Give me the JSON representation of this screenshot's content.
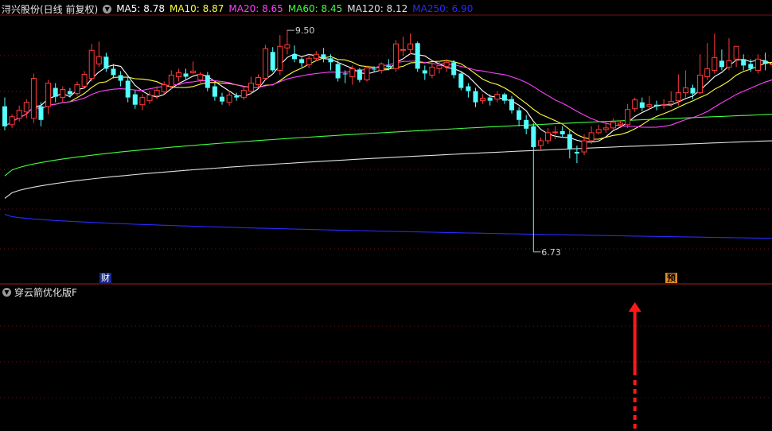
{
  "header": {
    "title": "浔兴股份(日线 前复权)",
    "dropdown_icon": "chevron-down-icon",
    "indicators": [
      {
        "label": "MA5: 8.78",
        "color": "#ffffff"
      },
      {
        "label": "MA10: 8.87",
        "color": "#ffff40"
      },
      {
        "label": "MA20: 8.65",
        "color": "#ff40ff"
      },
      {
        "label": "MA60: 8.45",
        "color": "#40ff40"
      },
      {
        "label": "MA120: 8.12",
        "color": "#e0e0e0"
      },
      {
        "label": "MA250: 6.90",
        "color": "#2a2aff"
      }
    ]
  },
  "sub_panel": {
    "title": "穿云箭优化版F",
    "signal_color": "#ff1a1a"
  },
  "markers": {
    "finance_label": "财",
    "forecast_label": "预"
  },
  "chart_data": {
    "type": "candlestick",
    "up_color": "#ff3a3a",
    "down_color": "#54ffff",
    "grid": true,
    "annotations": [
      {
        "text": "9.50",
        "value": 9.5,
        "candle_index": 39
      },
      {
        "text": "6.73",
        "value": 6.73,
        "candle_index": 73
      }
    ],
    "candles": [
      [
        8.55,
        8.3,
        8.66,
        8.25
      ],
      [
        8.32,
        8.42,
        8.45,
        8.28
      ],
      [
        8.4,
        8.5,
        8.56,
        8.36
      ],
      [
        8.48,
        8.6,
        8.64,
        8.4
      ],
      [
        8.4,
        8.9,
        8.96,
        8.34
      ],
      [
        8.55,
        8.38,
        8.6,
        8.3
      ],
      [
        8.55,
        8.84,
        8.88,
        8.45
      ],
      [
        8.78,
        8.67,
        8.84,
        8.6
      ],
      [
        8.66,
        8.76,
        8.8,
        8.6
      ],
      [
        8.74,
        8.7,
        8.78,
        8.66
      ],
      [
        8.71,
        8.82,
        8.86,
        8.68
      ],
      [
        8.8,
        8.95,
        8.99,
        8.78
      ],
      [
        8.9,
        9.25,
        9.33,
        8.86
      ],
      [
        9.08,
        9.17,
        9.36,
        9.04
      ],
      [
        9.17,
        9.02,
        9.22,
        8.98
      ],
      [
        9.02,
        8.94,
        9.08,
        8.9
      ],
      [
        8.94,
        8.87,
        8.99,
        8.8
      ],
      [
        8.87,
        8.66,
        8.92,
        8.6
      ],
      [
        8.7,
        8.57,
        8.75,
        8.52
      ],
      [
        8.57,
        8.66,
        8.7,
        8.5
      ],
      [
        8.62,
        8.69,
        8.74,
        8.58
      ],
      [
        8.68,
        8.75,
        8.8,
        8.64
      ],
      [
        8.73,
        8.82,
        8.86,
        8.7
      ],
      [
        8.8,
        8.94,
        9.0,
        8.76
      ],
      [
        8.92,
        8.97,
        9.02,
        8.86
      ],
      [
        8.96,
        8.92,
        9.02,
        8.89
      ],
      [
        8.97,
        8.99,
        9.11,
        8.95
      ],
      [
        8.88,
        8.95,
        8.98,
        8.84
      ],
      [
        8.94,
        8.78,
        8.98,
        8.74
      ],
      [
        8.8,
        8.67,
        8.84,
        8.62
      ],
      [
        8.67,
        8.61,
        8.72,
        8.57
      ],
      [
        8.6,
        8.69,
        8.74,
        8.56
      ],
      [
        8.68,
        8.66,
        8.72,
        8.62
      ],
      [
        8.66,
        8.75,
        8.8,
        8.63
      ],
      [
        8.74,
        8.84,
        8.92,
        8.7
      ],
      [
        8.82,
        8.91,
        8.95,
        8.79
      ],
      [
        8.9,
        9.27,
        9.32,
        8.88
      ],
      [
        9.23,
        9.0,
        9.29,
        8.98
      ],
      [
        9.0,
        9.3,
        9.44,
        8.94
      ],
      [
        9.28,
        9.32,
        9.5,
        9.2
      ],
      [
        9.2,
        9.14,
        9.31,
        9.1
      ],
      [
        9.14,
        9.09,
        9.16,
        9.04
      ],
      [
        9.07,
        9.15,
        9.2,
        9.03
      ],
      [
        9.15,
        9.2,
        9.24,
        9.12
      ],
      [
        9.2,
        9.15,
        9.28,
        9.1
      ],
      [
        9.15,
        9.1,
        9.2,
        9.0
      ],
      [
        9.08,
        8.9,
        9.12,
        8.86
      ],
      [
        8.96,
        8.95,
        9.0,
        8.84
      ],
      [
        8.92,
        9.02,
        9.06,
        8.82
      ],
      [
        9.01,
        8.88,
        9.03,
        8.85
      ],
      [
        8.88,
        9.03,
        9.06,
        8.86
      ],
      [
        9.02,
        9.01,
        9.05,
        8.98
      ],
      [
        9.0,
        9.08,
        9.1,
        8.96
      ],
      [
        9.06,
        9.04,
        9.14,
        9.0
      ],
      [
        9.02,
        9.33,
        9.38,
        8.98
      ],
      [
        9.25,
        9.26,
        9.42,
        9.18
      ],
      [
        9.26,
        9.33,
        9.46,
        9.2
      ],
      [
        9.34,
        9.02,
        9.36,
        8.98
      ],
      [
        9.0,
        8.96,
        9.06,
        8.88
      ],
      [
        8.94,
        9.04,
        9.1,
        8.9
      ],
      [
        9.02,
        9.06,
        9.12,
        8.96
      ],
      [
        9.05,
        9.1,
        9.14,
        8.98
      ],
      [
        9.1,
        8.94,
        9.13,
        8.9
      ],
      [
        8.96,
        8.78,
        8.99,
        8.75
      ],
      [
        8.8,
        8.74,
        8.84,
        8.66
      ],
      [
        8.74,
        8.6,
        8.78,
        8.54
      ],
      [
        8.62,
        8.65,
        8.7,
        8.58
      ],
      [
        8.66,
        8.62,
        8.7,
        8.56
      ],
      [
        8.64,
        8.7,
        8.74,
        8.6
      ],
      [
        8.7,
        8.62,
        8.72,
        8.58
      ],
      [
        8.64,
        8.5,
        8.68,
        8.46
      ],
      [
        8.5,
        8.38,
        8.54,
        8.3
      ],
      [
        8.38,
        8.27,
        8.44,
        8.2
      ],
      [
        8.3,
        8.04,
        8.34,
        6.73
      ],
      [
        8.06,
        8.12,
        8.16,
        8.0
      ],
      [
        8.12,
        8.22,
        8.28,
        8.08
      ],
      [
        8.22,
        8.23,
        8.3,
        8.14
      ],
      [
        8.24,
        8.2,
        8.3,
        8.16
      ],
      [
        8.2,
        8.02,
        8.25,
        7.9
      ],
      [
        7.98,
        7.96,
        8.06,
        7.84
      ],
      [
        7.98,
        8.12,
        8.2,
        7.94
      ],
      [
        8.12,
        8.22,
        8.3,
        8.08
      ],
      [
        8.22,
        8.26,
        8.32,
        8.2
      ],
      [
        8.26,
        8.28,
        8.36,
        8.22
      ],
      [
        8.28,
        8.35,
        8.4,
        8.26
      ],
      [
        8.32,
        8.34,
        8.37,
        8.29
      ],
      [
        8.32,
        8.51,
        8.58,
        8.28
      ],
      [
        8.52,
        8.63,
        8.66,
        8.48
      ],
      [
        8.6,
        8.53,
        8.66,
        8.49
      ],
      [
        8.55,
        8.57,
        8.68,
        8.5
      ],
      [
        8.57,
        8.55,
        8.62,
        8.5
      ],
      [
        8.56,
        8.57,
        8.64,
        8.52
      ],
      [
        8.58,
        8.61,
        8.74,
        8.54
      ],
      [
        8.62,
        8.72,
        8.95,
        8.56
      ],
      [
        8.72,
        8.78,
        9.0,
        8.66
      ],
      [
        8.78,
        8.71,
        8.82,
        8.64
      ],
      [
        8.72,
        8.94,
        9.2,
        8.7
      ],
      [
        8.92,
        9.02,
        9.34,
        8.88
      ],
      [
        9.0,
        9.16,
        9.46,
        8.96
      ],
      [
        9.12,
        9.04,
        9.26,
        9.0
      ],
      [
        9.04,
        9.12,
        9.4,
        9.0
      ],
      [
        9.14,
        9.3,
        9.3,
        9.04
      ],
      [
        9.14,
        9.06,
        9.2,
        9.0
      ],
      [
        9.08,
        9.02,
        9.14,
        8.98
      ],
      [
        9.0,
        9.14,
        9.2,
        8.96
      ],
      [
        9.12,
        9.08,
        9.22,
        9.0
      ],
      [
        9.08,
        9.08,
        9.14,
        9.02
      ]
    ],
    "ma_series": [
      {
        "name": "MA5",
        "color": "#ffffff"
      },
      {
        "name": "MA10",
        "color": "#ffff40"
      },
      {
        "name": "MA20",
        "color": "#ff40ff"
      },
      {
        "name": "MA60",
        "color": "#40ff40",
        "values": [
          7.68,
          8.45
        ]
      },
      {
        "name": "MA120",
        "color": "#e0e0e0",
        "values": [
          7.4,
          8.12
        ]
      },
      {
        "name": "MA250",
        "color": "#2a2aff",
        "values": [
          7.2,
          6.9
        ]
      }
    ],
    "signal_arrow": {
      "candle_index": 87,
      "direction": "up"
    }
  }
}
